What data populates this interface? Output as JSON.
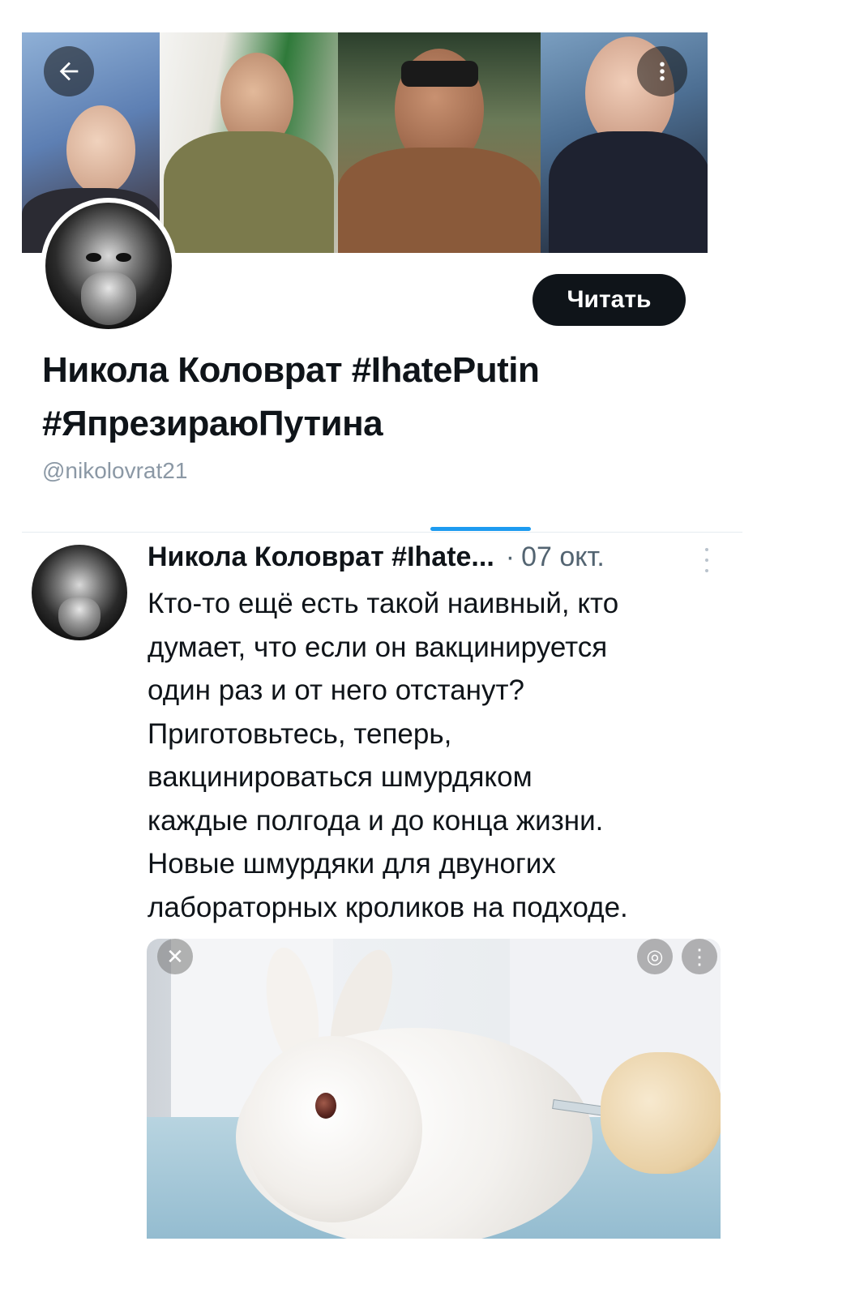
{
  "header": {
    "back_label": "←",
    "more_label": "⋮"
  },
  "profile": {
    "follow_label": "Читать",
    "display_name": "Никола Коловрат #IhatePutin #ЯпрезираюПутина",
    "handle": "@nikolovrat21"
  },
  "tweet": {
    "author": "Никола Коловрат #Ihate...",
    "separator": "·",
    "date": "07 окт.",
    "text": "Кто-то ещё есть такой наивный, кто\nдумает, что если он вакцинируется\nодин раз и от него отстанут?\nПриготовьтесь, теперь,\nвакцинироваться шмурдяком\nкаждые полгода и до конца жизни.\nНовые шмурдяки для двуногих\nлабораторных кроликов на подходе."
  },
  "media": {
    "close_label": "✕",
    "lens_label": "◎",
    "more_label": "⋮"
  },
  "colors": {
    "accent": "#1d9bf0",
    "text_primary": "#0f1419",
    "text_secondary": "#536471",
    "button_dark": "#0f1419"
  },
  "icons": [
    "back-arrow-icon",
    "more-vertical-icon",
    "close-icon",
    "lens-search-icon"
  ]
}
